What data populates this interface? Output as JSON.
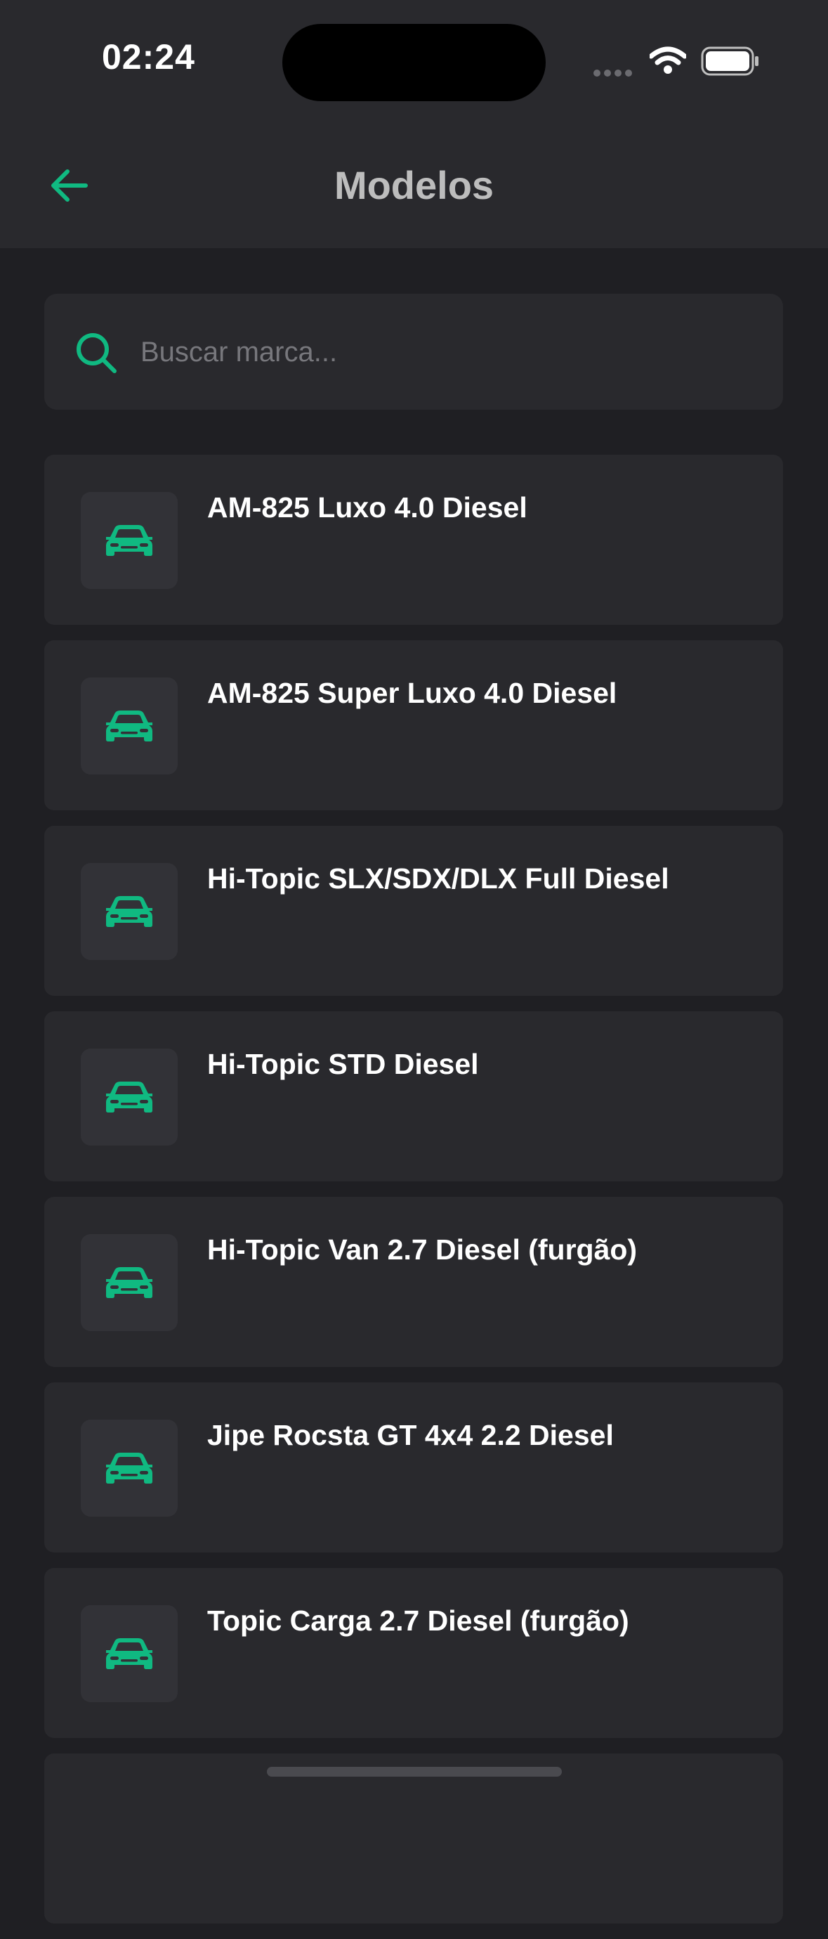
{
  "status_bar": {
    "time": "02:24"
  },
  "header": {
    "title": "Modelos"
  },
  "search": {
    "placeholder": "Buscar marca..."
  },
  "models": [
    "AM-825 Luxo 4.0 Diesel",
    "AM-825 Super Luxo 4.0 Diesel",
    "Hi-Topic SLX/SDX/DLX Full Diesel",
    "Hi-Topic STD Diesel",
    "Hi-Topic Van 2.7 Diesel (furgão)",
    "Jipe Rocsta GT 4x4 2.2 Diesel",
    "Topic Carga 2.7 Diesel (furgão)"
  ],
  "icons": {
    "back": "arrow-left-icon",
    "search": "search-icon",
    "item": "car-icon"
  },
  "colors": {
    "accent": "#10b981",
    "background": "#1f1f23",
    "surface": "#29292d",
    "title": "#bdbdbd"
  }
}
